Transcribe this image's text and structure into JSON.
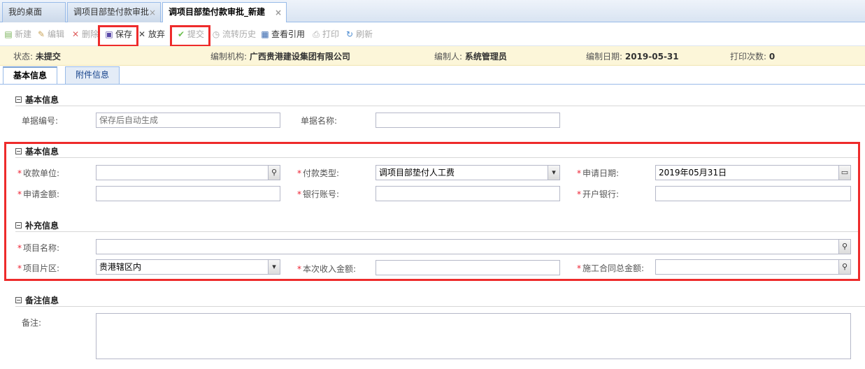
{
  "tabs": [
    {
      "label": "我的桌面"
    },
    {
      "label": "调项目部垫付款审批"
    },
    {
      "label": "调项目部垫付款审批_新建"
    }
  ],
  "toolbar": {
    "new": "新建",
    "edit": "编辑",
    "delete": "删除",
    "save": "保存",
    "discard": "放弃",
    "submit": "提交",
    "history": "流转历史",
    "view_ref": "查看引用",
    "print": "打印",
    "refresh": "刷新"
  },
  "status": {
    "status_label": "状态:",
    "status_value": "未提交",
    "org_label": "编制机构:",
    "org_value": "广西贵港建设集团有限公司",
    "author_label": "编制人:",
    "author_value": "系统管理员",
    "date_label": "编制日期:",
    "date_value": "2019-05-31",
    "print_label": "打印次数:",
    "print_value": "0"
  },
  "form_tabs": [
    {
      "label": "基本信息"
    },
    {
      "label": "附件信息"
    }
  ],
  "section1": {
    "title": "基本信息",
    "doc_no_label": "单据编号:",
    "doc_no_placeholder": "保存后自动生成",
    "doc_name_label": "单据名称:",
    "doc_name_value": ""
  },
  "section2": {
    "title": "基本信息",
    "payee_label": "收款单位:",
    "pay_type_label": "付款类型:",
    "pay_type_value": "调项目部垫付人工费",
    "apply_date_label": "申请日期:",
    "apply_date_value": "2019年05月31日",
    "amount_label": "申请金额:",
    "account_label": "银行账号:",
    "bank_label": "开户银行:"
  },
  "section3": {
    "title": "补充信息",
    "project_label": "项目名称:",
    "area_label": "项目片区:",
    "area_value": "贵港辖区内",
    "income_label": "本次收入金额:",
    "contract_label": "施工合同总金额:"
  },
  "section4": {
    "title": "备注信息",
    "remark_label": "备注:"
  },
  "colors": {
    "highlight": "#ee2b2b",
    "status_bg": "#fcf6d9",
    "required": "#e23"
  },
  "icons": [
    "new-icon",
    "edit-icon",
    "delete-icon",
    "save-icon",
    "discard-icon",
    "submit-icon",
    "history-icon",
    "view-ref-icon",
    "print-icon",
    "refresh-icon",
    "search-icon",
    "calendar-icon",
    "chevron-down-icon",
    "close-icon",
    "collapse-icon"
  ]
}
